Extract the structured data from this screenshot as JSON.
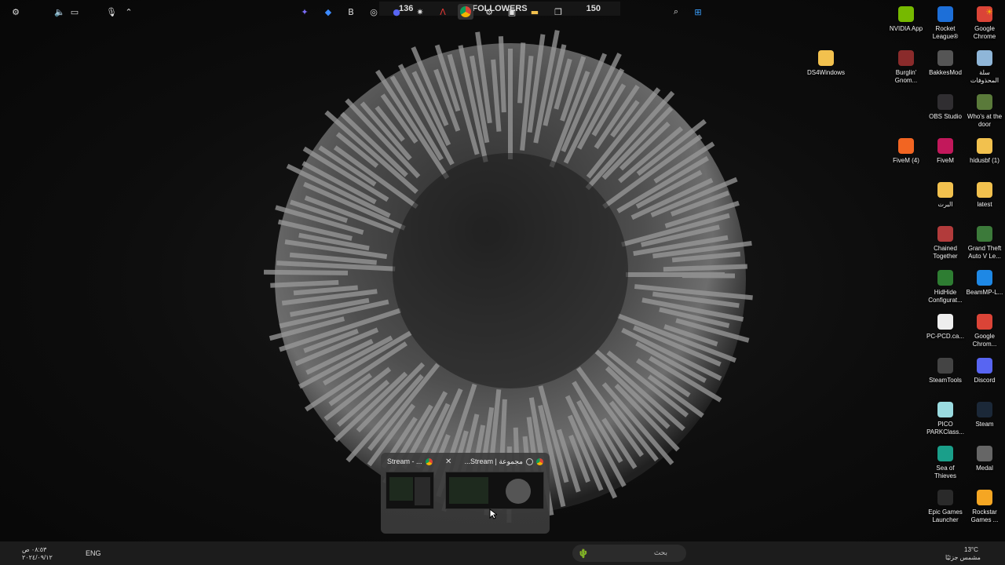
{
  "stream_overlay": {
    "left_count": "136",
    "title": "FOLLOWERS",
    "right_count": "150"
  },
  "desktop_icons": [
    {
      "label": "NVIDIA App",
      "icon": "nvidia-icon",
      "color": "#76b900"
    },
    {
      "label": "Rocket League®",
      "icon": "rocket-league-icon",
      "color": "#1d6fd8"
    },
    {
      "label": "Google Chrome",
      "icon": "chrome-icon",
      "color": "#db4437"
    },
    {
      "label": "DS4Windows",
      "icon": "folder-icon",
      "color": "#f2c14e"
    },
    {
      "label": "Burglin' Gnom...",
      "icon": "game-icon",
      "color": "#8a2b2b"
    },
    {
      "label": "BakkesMod",
      "icon": "bakkesmod-icon",
      "color": "#555555"
    },
    {
      "label": "سلة المحذوفات",
      "icon": "recycle-bin-icon",
      "color": "#8fb6d8"
    },
    {
      "label": "OBS Studio",
      "icon": "obs-icon",
      "color": "#302e31"
    },
    {
      "label": "Who's at the door",
      "icon": "game-icon",
      "color": "#5a7a3a"
    },
    {
      "label": "FiveM (4)",
      "icon": "fivem-icon",
      "color": "#f26522"
    },
    {
      "label": "FiveM",
      "icon": "fivem-icon",
      "color": "#c2185b"
    },
    {
      "label": "hidusbf (1)",
      "icon": "folder-icon",
      "color": "#f2c14e"
    },
    {
      "label": "البرت",
      "icon": "folder-icon",
      "color": "#f2c14e"
    },
    {
      "label": "latest",
      "icon": "folder-icon",
      "color": "#f2c14e"
    },
    {
      "label": "Chained Together",
      "icon": "game-icon",
      "color": "#b23b3b"
    },
    {
      "label": "Grand Theft Auto V Le...",
      "icon": "gta-icon",
      "color": "#3c7a3a"
    },
    {
      "label": "HidHide Configurat...",
      "icon": "hidhide-icon",
      "color": "#2e7d32"
    },
    {
      "label": "BeamMP-L...",
      "icon": "beammp-icon",
      "color": "#1e88e5"
    },
    {
      "label": "PC-PCD.ca...",
      "icon": "file-icon",
      "color": "#eeeeee"
    },
    {
      "label": "Google Chrom...",
      "icon": "chrome-icon",
      "color": "#db4437"
    },
    {
      "label": "SteamTools",
      "icon": "steamtools-icon",
      "color": "#444444"
    },
    {
      "label": "Discord",
      "icon": "discord-icon",
      "color": "#5865f2"
    },
    {
      "label": "PICO PARKClass...",
      "icon": "pico-park-icon",
      "color": "#9adbe0"
    },
    {
      "label": "Steam",
      "icon": "steam-icon",
      "color": "#1b2838"
    },
    {
      "label": "Sea of Thieves",
      "icon": "sea-of-thieves-icon",
      "color": "#1a9f8a"
    },
    {
      "label": "Medal",
      "icon": "medal-icon",
      "color": "#666666"
    },
    {
      "label": "Epic Games Launcher",
      "icon": "epic-games-icon",
      "color": "#2a2a2a"
    },
    {
      "label": "Rockstar Games ...",
      "icon": "rockstar-icon",
      "color": "#f5a623"
    }
  ],
  "window_previews": [
    {
      "title": "Stream - ...",
      "close_glyph": "✕"
    },
    {
      "title": "...Stream | مجموعة"
    }
  ],
  "taskbar": {
    "search_placeholder": "بحث",
    "language": "ENG",
    "time": "٠٨:٥٣ ص",
    "date": "٢٠٢٤/٠٩/١٢",
    "weather_temp": "13°C",
    "weather_desc": "مشمس جزئيًا"
  }
}
